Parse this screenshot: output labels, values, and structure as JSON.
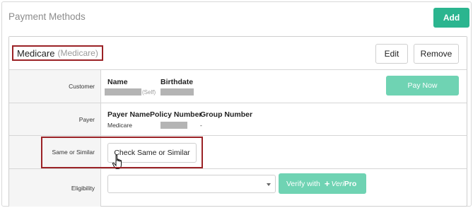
{
  "panel": {
    "title": "Payment Methods",
    "add_label": "Add"
  },
  "card": {
    "title": "Medicare",
    "subtitle": "(Medicare)",
    "edit_label": "Edit",
    "remove_label": "Remove"
  },
  "customer": {
    "label": "Customer",
    "name_header": "Name",
    "birthdate_header": "Birthdate",
    "self_tag": "(Self)",
    "pay_now_label": "Pay Now"
  },
  "payer": {
    "label": "Payer",
    "payer_name_header": "Payer Name",
    "policy_number_header": "Policy Number",
    "group_number_header": "Group Number",
    "payer_name_value": "Medicare",
    "group_number_value": "-"
  },
  "same_or_similar": {
    "label": "Same or Similar",
    "check_label": "Check Same or Similar"
  },
  "eligibility": {
    "label": "Eligibility",
    "select_value": "",
    "verify_label": "Verify with",
    "logo_plus": "+",
    "logo_part1": "Veri",
    "logo_part2": "Pro"
  },
  "colors": {
    "accent": "#2bb58f",
    "accent_light": "#6fd3b3",
    "highlight_border": "#9b2226",
    "redaction": "#b4b4b4"
  },
  "icons": {
    "cursor": "hand-pointer-icon",
    "dropdown": "caret-down-icon"
  }
}
